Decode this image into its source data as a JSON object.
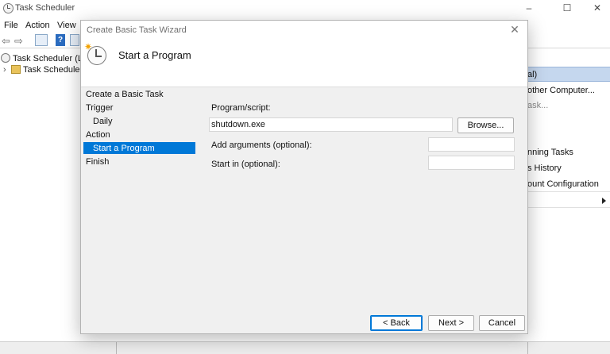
{
  "app": {
    "title": "Task Scheduler",
    "menu": [
      "File",
      "Action",
      "View"
    ],
    "window_controls": [
      "–",
      "☐",
      "✕"
    ]
  },
  "tree": {
    "root_label": "Task Scheduler (Loca",
    "library_label": "Task Scheduler L"
  },
  "actions_pane": {
    "header": "al)",
    "items": [
      "other Computer...",
      "ask...",
      "nning Tasks",
      "s History",
      "ount Configuration"
    ]
  },
  "dialog": {
    "title": "Create Basic Task Wizard",
    "header_title": "Start a Program",
    "steps": [
      {
        "label": "Create a Basic Task"
      },
      {
        "label": "Trigger"
      },
      {
        "label": "Daily"
      },
      {
        "label": "Action"
      },
      {
        "label": "Start a Program"
      },
      {
        "label": "Finish"
      }
    ],
    "program_label": "Program/script:",
    "program_value": "shutdown.exe",
    "browse_label": "Browse...",
    "arguments_label": "Add arguments (optional):",
    "arguments_value": "",
    "startin_label": "Start in (optional):",
    "startin_value": "",
    "back_label": "< Back",
    "next_label": "Next >",
    "cancel_label": "Cancel"
  },
  "colors": {
    "accent": "#0078d7",
    "header_highlight": "#c5d7ee"
  },
  "icons": [
    "task-scheduler-icon",
    "back-arrow-icon",
    "forward-arrow-icon",
    "help-icon",
    "close-icon",
    "wizard-clock-icon",
    "chevron-right-icon"
  ]
}
